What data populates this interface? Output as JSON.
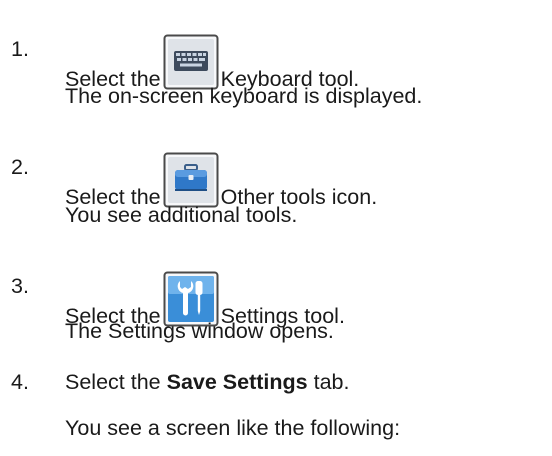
{
  "steps": [
    {
      "number": "1.",
      "before": "Select the",
      "icon": "keyboard-icon",
      "after": "Keyboard tool.",
      "result": "The on-screen keyboard is displayed."
    },
    {
      "number": "2.",
      "before": "Select the",
      "icon": "toolbox-icon",
      "after": "Other tools icon.",
      "result": "You see additional tools."
    },
    {
      "number": "3.",
      "before": "Select the",
      "icon": "settings-tools-icon",
      "after": "Settings tool.",
      "result": "The Settings window opens."
    },
    {
      "number": "4.",
      "before": "Select the",
      "bold": "Save Settings",
      "after": "tab.",
      "result": "You see a screen like the following:"
    }
  ],
  "colors": {
    "text": "#1a1a1a",
    "icon_frame": "#4a4a4a",
    "icon_bg": "#dfe3e8",
    "icon_blue": "#2f78c8"
  }
}
